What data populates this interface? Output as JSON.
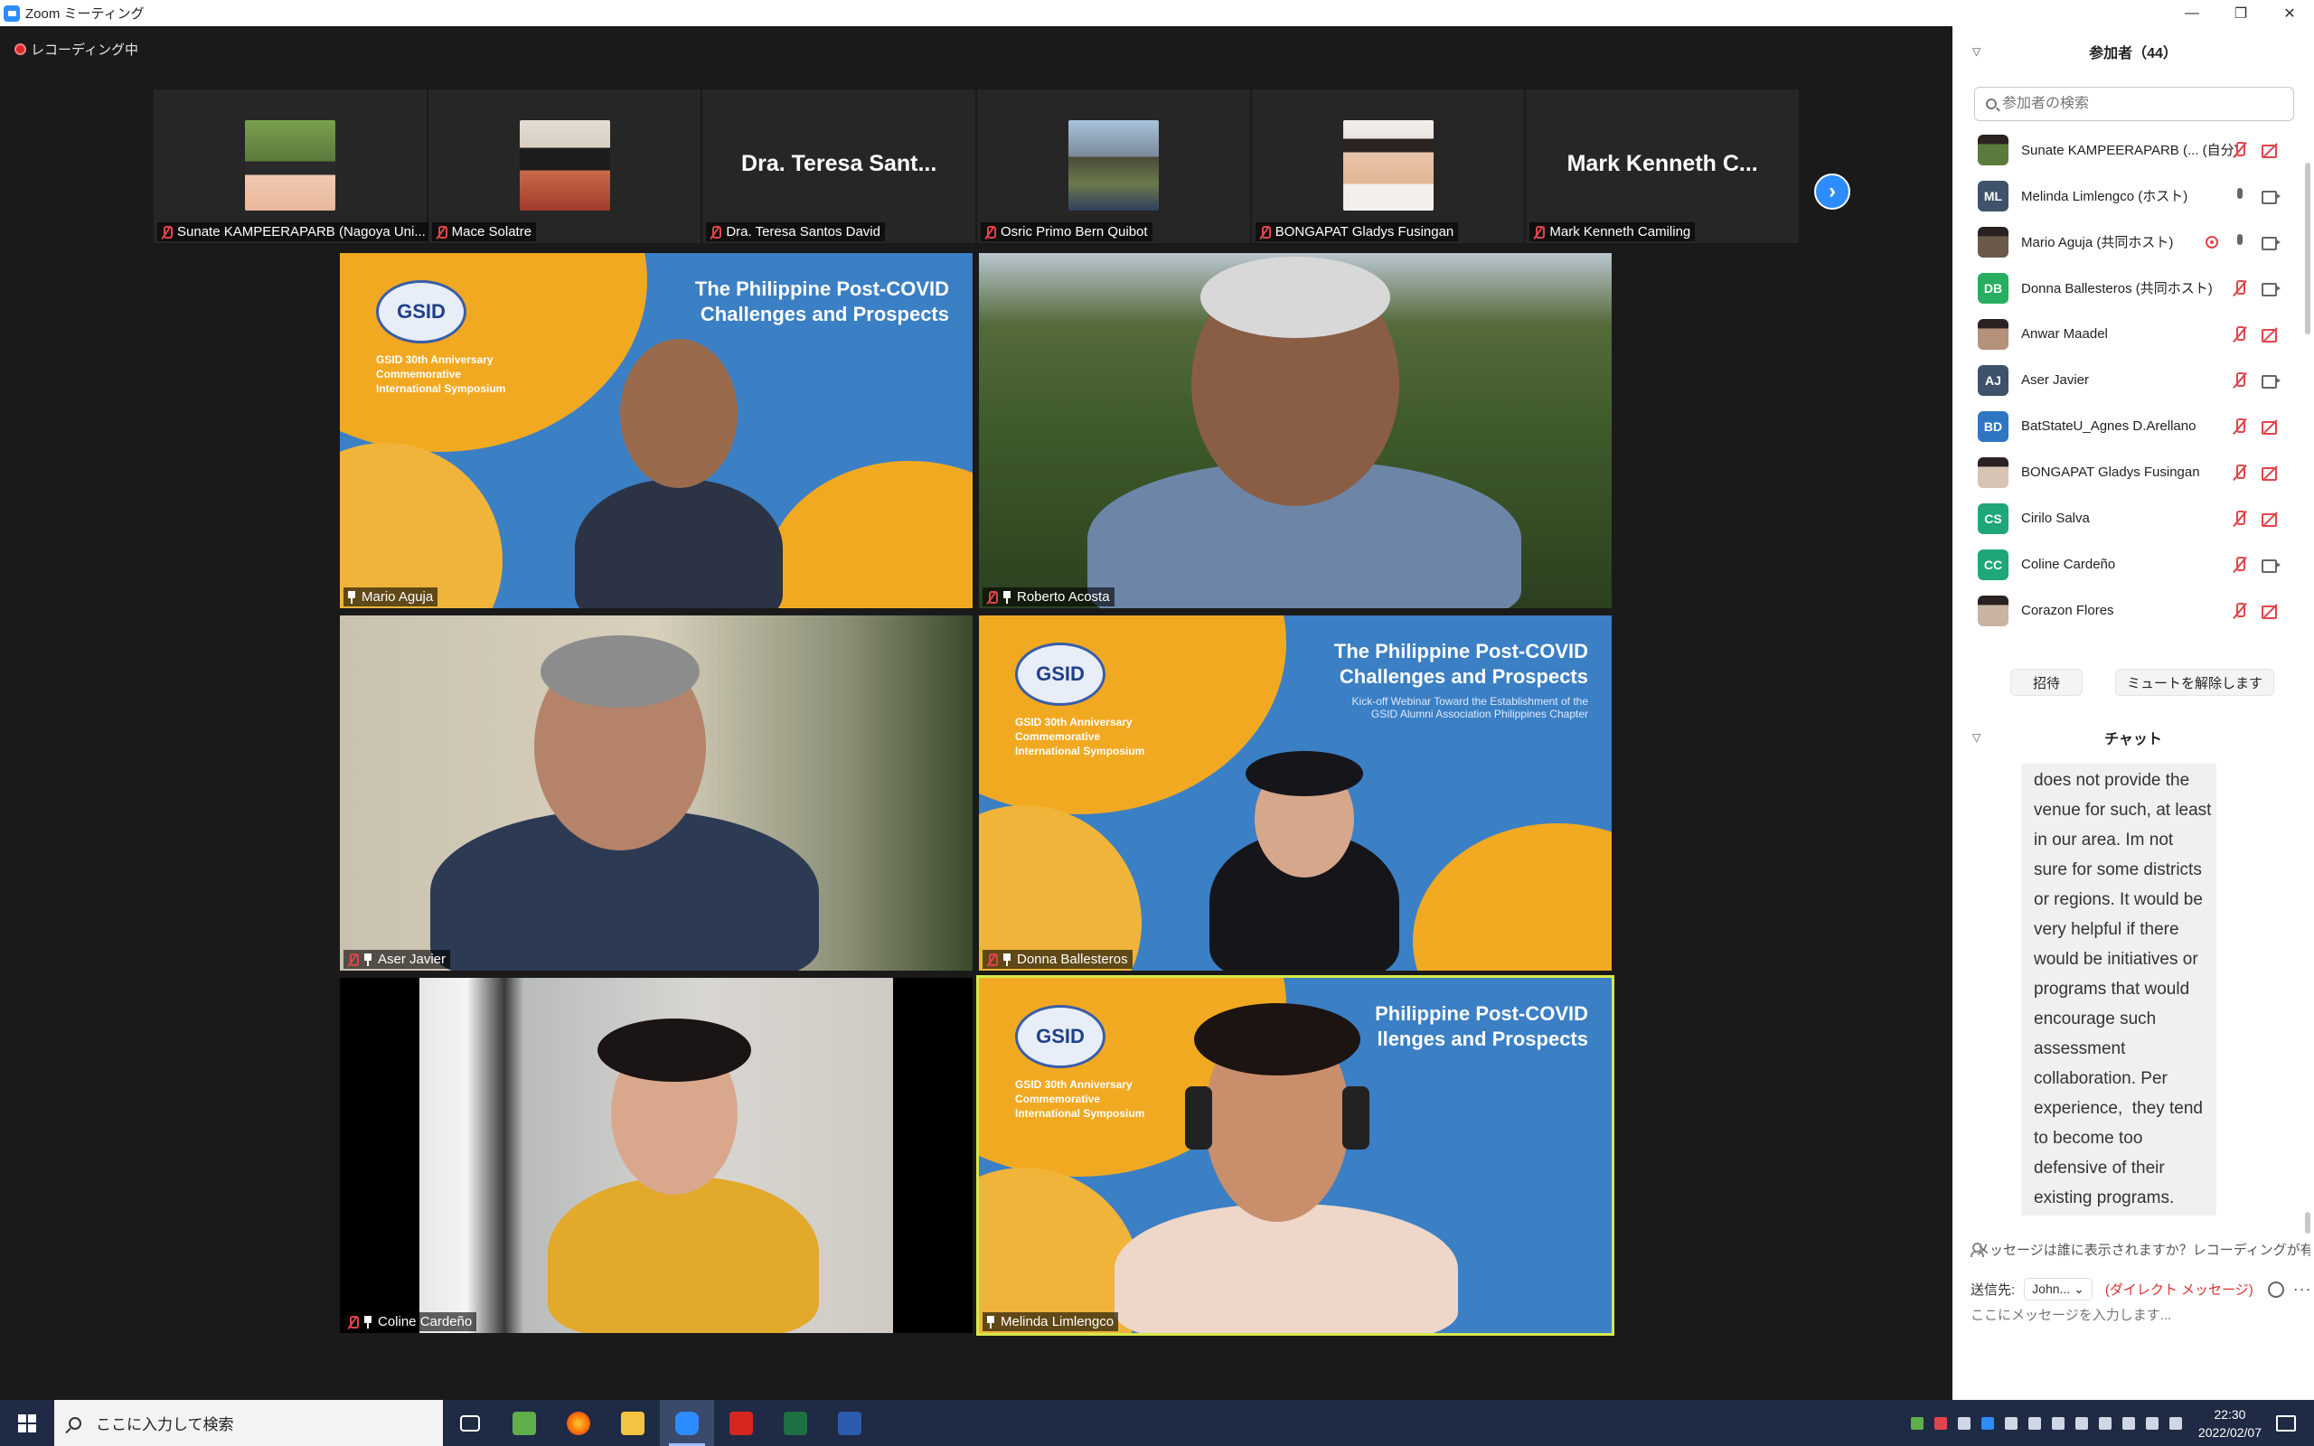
{
  "window": {
    "title": "Zoom ミーティング"
  },
  "meeting": {
    "recording_label": "レコーディング中",
    "thumbnails": [
      {
        "name": "Sunate KAMPEERAPARB (Nagoya Uni...",
        "has_photo": true,
        "photo_color": "#5c7a3c"
      },
      {
        "name": "Mace Solatre",
        "has_photo": true,
        "photo_color": "#d9cfc3"
      },
      {
        "name": "Dra. Teresa Santos David",
        "display_name": "Dra. Teresa Sant...",
        "has_photo": false
      },
      {
        "name": "Osric Primo Bern Quibot",
        "has_photo": true,
        "photo_color": "#7b8a9a"
      },
      {
        "name": "BONGAPAT Gladys Fusingan",
        "has_photo": true,
        "photo_color": "#e9e4de"
      },
      {
        "name": "Mark Kenneth Camiling",
        "display_name": "Mark Kenneth C...",
        "has_photo": false
      }
    ],
    "tiles": [
      {
        "name": "Mario Aguja"
      },
      {
        "name": "Roberto Acosta"
      },
      {
        "name": "Aser Javier"
      },
      {
        "name": "Donna Ballesteros"
      },
      {
        "name": "Coline Cardeño"
      },
      {
        "name": "Melinda Limlengco"
      }
    ],
    "slide": {
      "title_line1": "The Philippine Post-COVID",
      "title_line2": "Challenges and Prospects",
      "sub_line1": "Kick-off Webinar Toward the Establishment of the",
      "sub_line2": "GSID Alumni Association Philippines Chapter",
      "logo": "GSID",
      "anniv_line1": "GSID 30th Anniversary",
      "anniv_line2": "Commemorative",
      "anniv_line3": "International Symposium",
      "title_partial_line1": "Philippine Post-COVID",
      "title_partial_line2": "llenges and Prospects"
    }
  },
  "panel": {
    "participants_header": "参加者（44）",
    "search_placeholder": "参加者の検索",
    "participants": [
      {
        "name": "Sunate KAMPEERAPARB (... (自分)",
        "avatar_type": "photo",
        "avatar_color": "#5c7a3c",
        "initials": "",
        "mic": "off",
        "cam": "off",
        "record": false
      },
      {
        "name": "Melinda Limlengco (ホスト)",
        "avatar_type": "initials",
        "avatar_color": "#3e5269",
        "initials": "ML",
        "mic": "on",
        "cam": "on",
        "record": false
      },
      {
        "name": "Mario Aguja (共同ホスト)",
        "avatar_type": "photo",
        "avatar_color": "#6b5a4a",
        "initials": "",
        "mic": "on",
        "cam": "on",
        "record": true
      },
      {
        "name": "Donna Ballesteros (共同ホスト)",
        "avatar_type": "initials",
        "avatar_color": "#27ae60",
        "initials": "DB",
        "mic": "off",
        "cam": "on",
        "record": false
      },
      {
        "name": "Anwar Maadel",
        "avatar_type": "photo",
        "avatar_color": "#b5917a",
        "initials": "",
        "mic": "off",
        "cam": "off",
        "record": false
      },
      {
        "name": "Aser Javier",
        "avatar_type": "initials",
        "avatar_color": "#3e5269",
        "initials": "AJ",
        "mic": "off",
        "cam": "on",
        "record": false
      },
      {
        "name": "BatStateU_Agnes D.Arellano",
        "avatar_type": "initials",
        "avatar_color": "#2d76c2",
        "initials": "BD",
        "mic": "off",
        "cam": "off",
        "record": false
      },
      {
        "name": "BONGAPAT Gladys Fusingan",
        "avatar_type": "photo",
        "avatar_color": "#d7c4b5",
        "initials": "",
        "mic": "off",
        "cam": "off",
        "record": false
      },
      {
        "name": "Cirilo Salva",
        "avatar_type": "initials",
        "avatar_color": "#1fa67a",
        "initials": "CS",
        "mic": "off",
        "cam": "off",
        "record": false
      },
      {
        "name": "Coline Cardeño",
        "avatar_type": "initials",
        "avatar_color": "#1fa67a",
        "initials": "CC",
        "mic": "off",
        "cam": "on",
        "record": false
      },
      {
        "name": "Corazon Flores",
        "avatar_type": "photo",
        "avatar_color": "#c9b4a2",
        "initials": "",
        "mic": "off",
        "cam": "off",
        "record": false
      }
    ],
    "invite_label": "招待",
    "unmute_label": "ミュートを解除します",
    "chat_header": "チャット",
    "chat_message_lines": [
      "does not provide the",
      "venue for such, at least",
      "in our area. Im not",
      "sure for some districts",
      "or regions. It would be",
      "very helpful if there",
      "would be initiatives or",
      "programs that would",
      "encourage such",
      "assessment",
      "collaboration. Per",
      "experience,  they tend",
      "to become too",
      "defensive of their",
      "existing programs."
    ],
    "notice": "メッセージは誰に表示されますか？レコーディングが有効",
    "sendto_label": "送信先:",
    "sendto_value": "John...",
    "dm_label": "(ダイレクト メッセージ)",
    "chat_placeholder": "ここにメッセージを入力します..."
  },
  "taskbar": {
    "search_placeholder": "ここに入力して検索",
    "time": "22:30",
    "date": "2022/02/07"
  }
}
